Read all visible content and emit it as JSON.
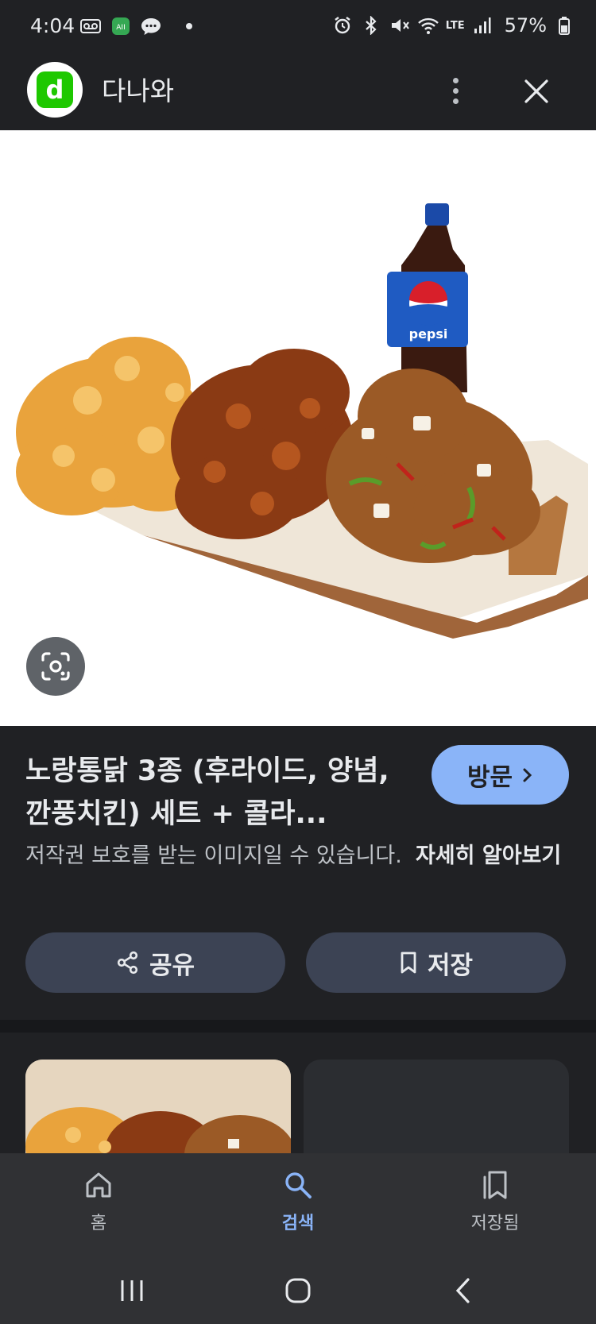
{
  "status_bar": {
    "time": "4:04",
    "battery": "57%",
    "network": "LTE"
  },
  "header": {
    "logo_letter": "d",
    "site_name": "다나와",
    "logo_color": "#1ec800"
  },
  "image": {
    "bottle_label": "pepsi"
  },
  "info": {
    "title": "노랑통닭 3종 (후라이드, 양념, 깐풍치킨) 세트 + 콜라...",
    "visit_label": "방문",
    "copyright_notice": "저작권 보호를 받는 이미지일 수 있습니다.",
    "learn_more": "자세히 알아보기",
    "share_label": "공유",
    "save_label": "저장"
  },
  "bottom_nav": {
    "items": [
      {
        "label": "홈",
        "icon": "home-icon",
        "active": false
      },
      {
        "label": "검색",
        "icon": "search-icon",
        "active": true
      },
      {
        "label": "저장됨",
        "icon": "collections-icon",
        "active": false
      }
    ]
  },
  "colors": {
    "background": "#202124",
    "accent": "#8ab4f8",
    "chip": "#3c4354"
  }
}
